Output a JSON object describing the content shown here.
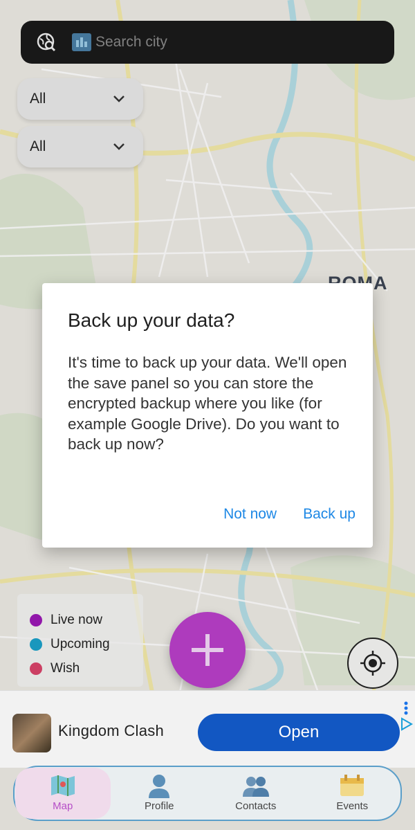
{
  "map": {
    "city_label": "ROMA"
  },
  "search": {
    "placeholder": "Search city"
  },
  "filters": [
    {
      "label": "All"
    },
    {
      "label": "All"
    }
  ],
  "dialog": {
    "title": "Back up your data?",
    "message": "It's time to back up your data. We'll open the save panel so you can store the encrypted backup where you like (for example Google Drive). Do you want to back up now?",
    "cancel_label": "Not now",
    "confirm_label": "Back up"
  },
  "legend": [
    {
      "label": "Live now",
      "color": "#9b19b5"
    },
    {
      "label": "Upcoming",
      "color": "#1ba1c9"
    },
    {
      "label": "Wish",
      "color": "#d9436a"
    }
  ],
  "ad": {
    "title": "Kingdom Clash",
    "button_label": "Open"
  },
  "nav": [
    {
      "label": "Map",
      "icon": "map-icon",
      "active": true
    },
    {
      "label": "Profile",
      "icon": "profile-icon",
      "active": false
    },
    {
      "label": "Contacts",
      "icon": "contacts-icon",
      "active": false
    },
    {
      "label": "Events",
      "icon": "events-icon",
      "active": false
    }
  ],
  "colors": {
    "accent": "#b93fc9",
    "dialog_action": "#1e88e5",
    "ad_button": "#1257c2"
  }
}
